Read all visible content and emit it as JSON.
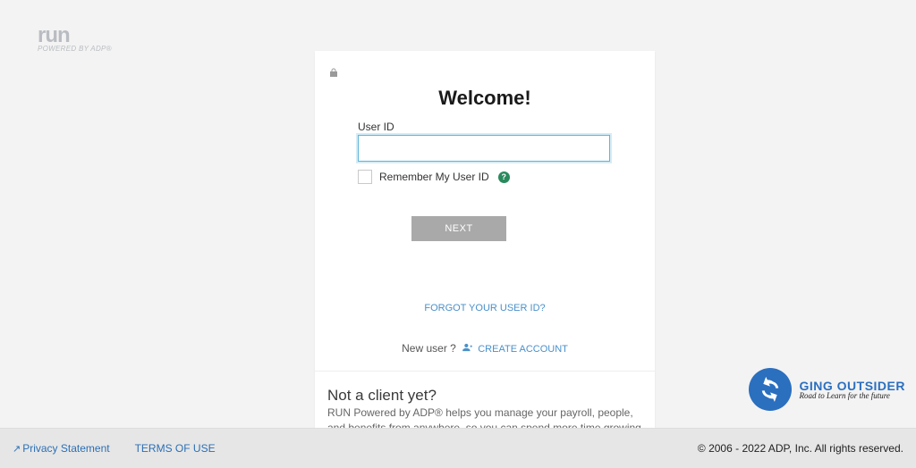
{
  "logo": {
    "main": "run",
    "sub": "POWERED BY ADP®"
  },
  "card": {
    "heading": "Welcome!",
    "userid_label": "User ID",
    "userid_value": "",
    "remember_label": "Remember My User ID",
    "next_label": "NEXT",
    "forgot_label": "FORGOT YOUR USER ID?",
    "newuser_prefix": "New user ?",
    "create_label": "CREATE ACCOUNT",
    "notclient_heading": "Not a client yet?",
    "notclient_body": "RUN Powered by ADP® helps you manage your payroll, people, and benefits from anywhere, so you can spend more time growing your business"
  },
  "watermark": {
    "main": "GING OUTSIDER",
    "sub": "Road to Learn for the future"
  },
  "footer": {
    "privacy": "Privacy Statement",
    "terms": "TERMS OF USE",
    "copyright": "© 2006 - 2022 ADP, Inc. All rights reserved."
  }
}
